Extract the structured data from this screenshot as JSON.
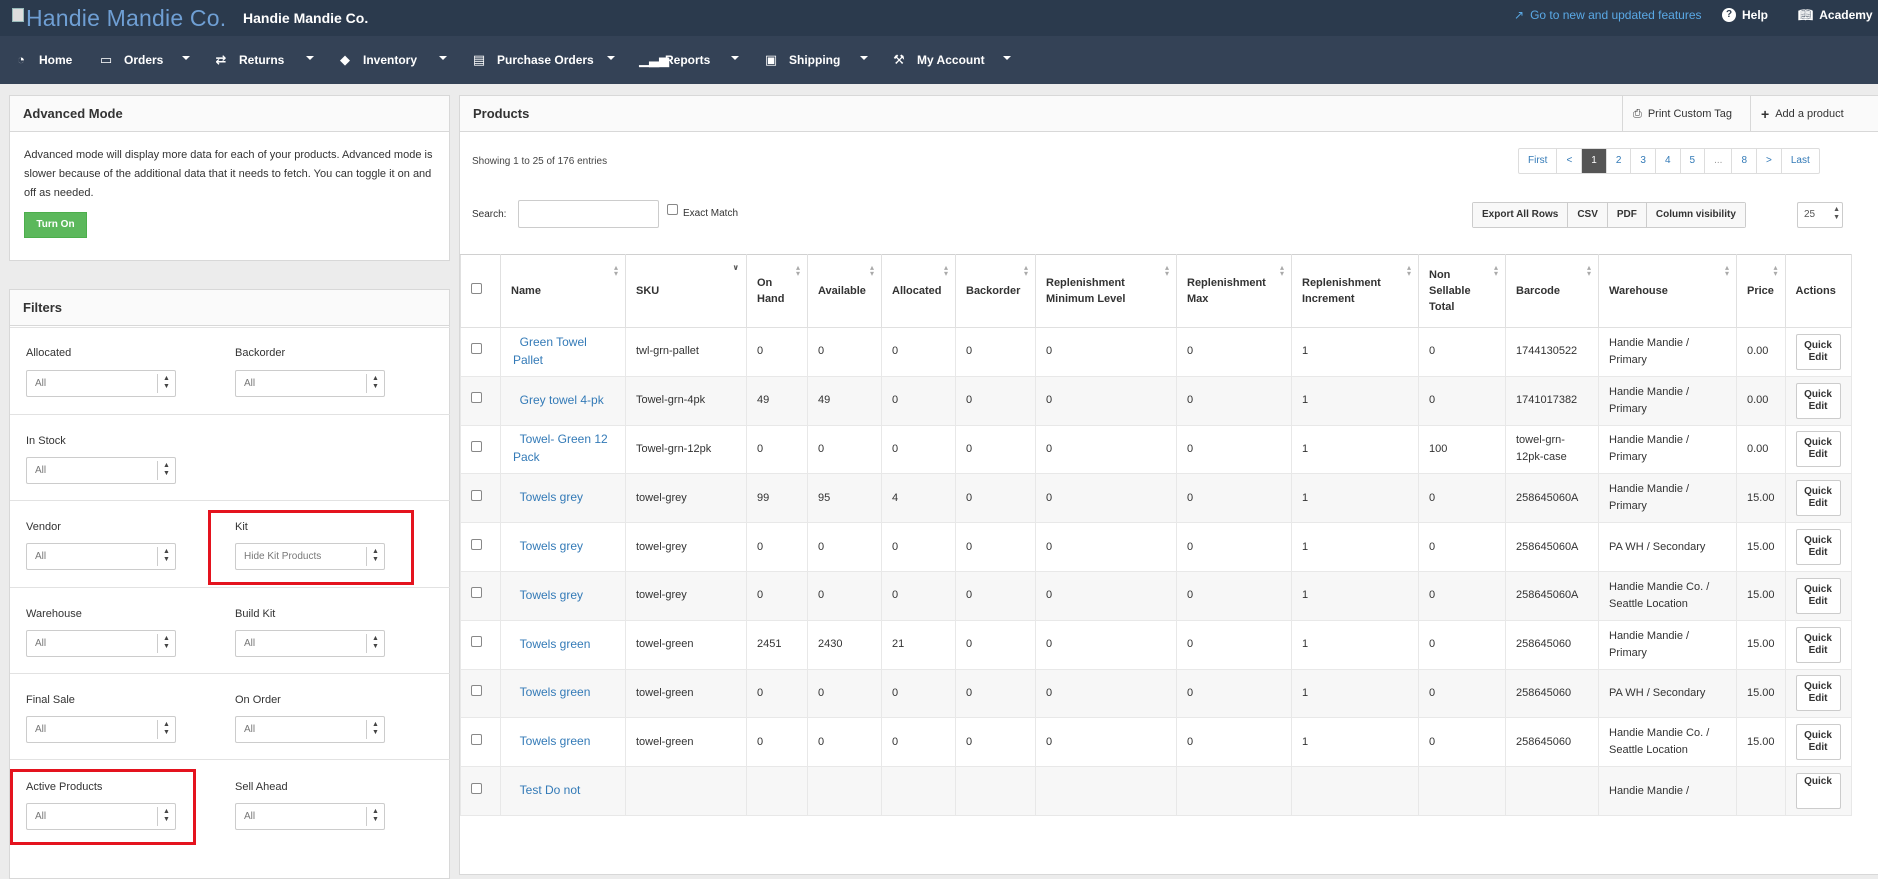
{
  "topbar": {
    "logo_alt": "Handie Mandie Co.",
    "brand": "Handie Mandie Co.",
    "new_features": "Go to new and updated features",
    "help": "Help",
    "academy": "Academy"
  },
  "nav": [
    {
      "label": "Home",
      "icon": "dashboard-icon"
    },
    {
      "label": "Orders",
      "icon": "inbox-icon"
    },
    {
      "label": "Returns",
      "icon": "exchange-icon"
    },
    {
      "label": "Inventory",
      "icon": "tag-icon"
    },
    {
      "label": "Purchase Orders",
      "icon": "file-icon"
    },
    {
      "label": "Reports",
      "icon": "bar-chart-icon"
    },
    {
      "label": "Shipping",
      "icon": "truck-icon"
    },
    {
      "label": "My Account",
      "icon": "wrench-icon"
    }
  ],
  "advanced": {
    "title": "Advanced Mode",
    "text": "Advanced mode will display more data for each of your products. Advanced mode is slower because of the additional data that it needs to fetch. You can toggle it on and off as needed.",
    "button": "Turn On"
  },
  "filters": {
    "title": "Filters",
    "items": [
      {
        "label": "Allocated",
        "value": "All"
      },
      {
        "label": "Backorder",
        "value": "All"
      },
      {
        "label": "In Stock",
        "value": "All"
      },
      {
        "label": "Vendor",
        "value": "All"
      },
      {
        "label": "Kit",
        "value": "Hide Kit Products"
      },
      {
        "label": "Warehouse",
        "value": "All"
      },
      {
        "label": "Build Kit",
        "value": "All"
      },
      {
        "label": "Final Sale",
        "value": "All"
      },
      {
        "label": "On Order",
        "value": "All"
      },
      {
        "label": "Active Products",
        "value": "All"
      },
      {
        "label": "Sell Ahead",
        "value": "All"
      }
    ]
  },
  "products": {
    "title": "Products",
    "print_tag": "Print Custom Tag",
    "add_product": "Add a product",
    "showing": "Showing 1 to 25 of 176 entries",
    "pager": [
      "First",
      "<",
      "1",
      "2",
      "3",
      "4",
      "5",
      "...",
      "8",
      ">",
      "Last"
    ],
    "search_label": "Search:",
    "exact_match": "Exact Match",
    "export_buttons": [
      "Export All Rows",
      "CSV",
      "PDF",
      "Column visibility"
    ],
    "page_size": "25",
    "columns": [
      "Name",
      "SKU",
      "On Hand",
      "Available",
      "Allocated",
      "Backorder",
      "Replenishment Minimum Level",
      "Replenishment Max",
      "Replenishment Increment",
      "Non Sellable Total",
      "Barcode",
      "Warehouse",
      "Price",
      "Actions"
    ],
    "quick_edit": "Quick Edit",
    "rows": [
      [
        "Green Towel Pallet",
        "twl-grn-pallet",
        "0",
        "0",
        "0",
        "0",
        "0",
        "0",
        "1",
        "0",
        "1744130522",
        "Handie Mandie / Primary",
        "0.00"
      ],
      [
        "Grey towel 4-pk",
        "Towel-grn-4pk",
        "49",
        "49",
        "0",
        "0",
        "0",
        "0",
        "1",
        "0",
        "1741017382",
        "Handie Mandie / Primary",
        "0.00"
      ],
      [
        "Towel- Green 12 Pack",
        "Towel-grn-12pk",
        "0",
        "0",
        "0",
        "0",
        "0",
        "0",
        "1",
        "100",
        "towel-grn-12pk-case",
        "Handie Mandie / Primary",
        "0.00"
      ],
      [
        "Towels grey",
        "towel-grey",
        "99",
        "95",
        "4",
        "0",
        "0",
        "0",
        "1",
        "0",
        "258645060A",
        "Handie Mandie / Primary",
        "15.00"
      ],
      [
        "Towels grey",
        "towel-grey",
        "0",
        "0",
        "0",
        "0",
        "0",
        "0",
        "1",
        "0",
        "258645060A",
        "PA WH / Secondary",
        "15.00"
      ],
      [
        "Towels grey",
        "towel-grey",
        "0",
        "0",
        "0",
        "0",
        "0",
        "0",
        "1",
        "0",
        "258645060A",
        "Handie Mandie Co. / Seattle Location",
        "15.00"
      ],
      [
        "Towels green",
        "towel-green",
        "2451",
        "2430",
        "21",
        "0",
        "0",
        "0",
        "1",
        "0",
        "258645060",
        "Handie Mandie / Primary",
        "15.00"
      ],
      [
        "Towels green",
        "towel-green",
        "0",
        "0",
        "0",
        "0",
        "0",
        "0",
        "1",
        "0",
        "258645060",
        "PA WH / Secondary",
        "15.00"
      ],
      [
        "Towels green",
        "towel-green",
        "0",
        "0",
        "0",
        "0",
        "0",
        "0",
        "1",
        "0",
        "258645060",
        "Handie Mandie Co. / Seattle Location",
        "15.00"
      ],
      [
        "Test Do not",
        "",
        "",
        "",
        "",
        "",
        "",
        "",
        "",
        "",
        "",
        "Handie Mandie /",
        ""
      ]
    ]
  }
}
